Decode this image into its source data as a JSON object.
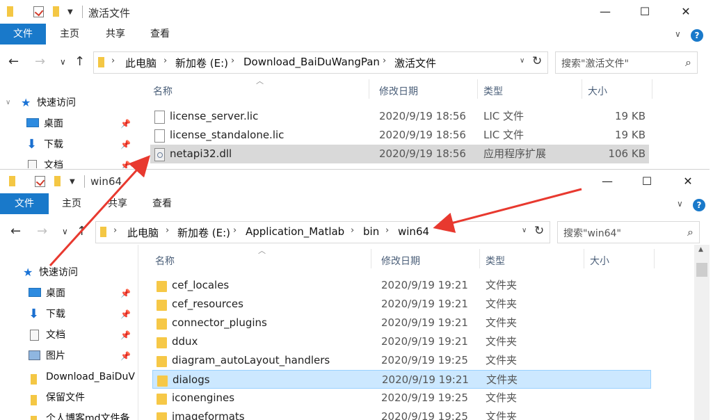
{
  "window1": {
    "title": "激活文件",
    "tabs": [
      "文件",
      "主页",
      "共享",
      "查看"
    ],
    "breadcrumb": [
      "此电脑",
      "新加卷 (E:)",
      "Download_BaiDuWangPan",
      "激活文件"
    ],
    "search_placeholder": "搜索\"激活文件\"",
    "columns": [
      "名称",
      "修改日期",
      "类型",
      "大小"
    ],
    "sidebar": [
      {
        "label": "快速访问",
        "icon": "star-icon"
      },
      {
        "label": "桌面",
        "icon": "desktop-icon"
      },
      {
        "label": "下载",
        "icon": "download-icon"
      },
      {
        "label": "文档",
        "icon": "document-icon"
      }
    ],
    "files": [
      {
        "name": "license_server.lic",
        "date": "2020/9/19 18:56",
        "type": "LIC 文件",
        "size": "19 KB",
        "icon": "file-icon"
      },
      {
        "name": "license_standalone.lic",
        "date": "2020/9/19 18:56",
        "type": "LIC 文件",
        "size": "19 KB",
        "icon": "file-icon"
      },
      {
        "name": "netapi32.dll",
        "date": "2020/9/19 18:56",
        "type": "应用程序扩展",
        "size": "106 KB",
        "icon": "dll-icon",
        "selected": true
      }
    ]
  },
  "window2": {
    "title": "win64",
    "tabs": [
      "文件",
      "主页",
      "共享",
      "查看"
    ],
    "breadcrumb": [
      "此电脑",
      "新加卷 (E:)",
      "Application_Matlab",
      "bin",
      "win64"
    ],
    "search_placeholder": "搜索\"win64\"",
    "columns": [
      "名称",
      "修改日期",
      "类型",
      "大小"
    ],
    "sidebar": [
      {
        "label": "快速访问",
        "icon": "star-icon"
      },
      {
        "label": "桌面",
        "icon": "desktop-icon",
        "pinned": true
      },
      {
        "label": "下载",
        "icon": "download-icon",
        "pinned": true
      },
      {
        "label": "文档",
        "icon": "document-icon",
        "pinned": true
      },
      {
        "label": "图片",
        "icon": "picture-icon",
        "pinned": true
      },
      {
        "label": "Download_BaiDuV",
        "icon": "folder-icon"
      },
      {
        "label": "保留文件",
        "icon": "folder-icon"
      },
      {
        "label": "个人博客md文件备",
        "icon": "folder-icon"
      }
    ],
    "files": [
      {
        "name": "cef_locales",
        "date": "2020/9/19 19:21",
        "type": "文件夹"
      },
      {
        "name": "cef_resources",
        "date": "2020/9/19 19:21",
        "type": "文件夹"
      },
      {
        "name": "connector_plugins",
        "date": "2020/9/19 19:21",
        "type": "文件夹"
      },
      {
        "name": "ddux",
        "date": "2020/9/19 19:21",
        "type": "文件夹"
      },
      {
        "name": "diagram_autoLayout_handlers",
        "date": "2020/9/19 19:25",
        "type": "文件夹"
      },
      {
        "name": "dialogs",
        "date": "2020/9/19 19:21",
        "type": "文件夹",
        "selected": true
      },
      {
        "name": "iconengines",
        "date": "2020/9/19 19:25",
        "type": "文件夹"
      },
      {
        "name": "imageformats",
        "date": "2020/9/19 19:25",
        "type": "文件夹"
      }
    ]
  },
  "colors": {
    "ribbon_file_tab": "#1979ca",
    "selection_blue": "#cce8ff",
    "selection_grey": "#d9d9d9",
    "annotation_arrow": "#e8392f"
  }
}
